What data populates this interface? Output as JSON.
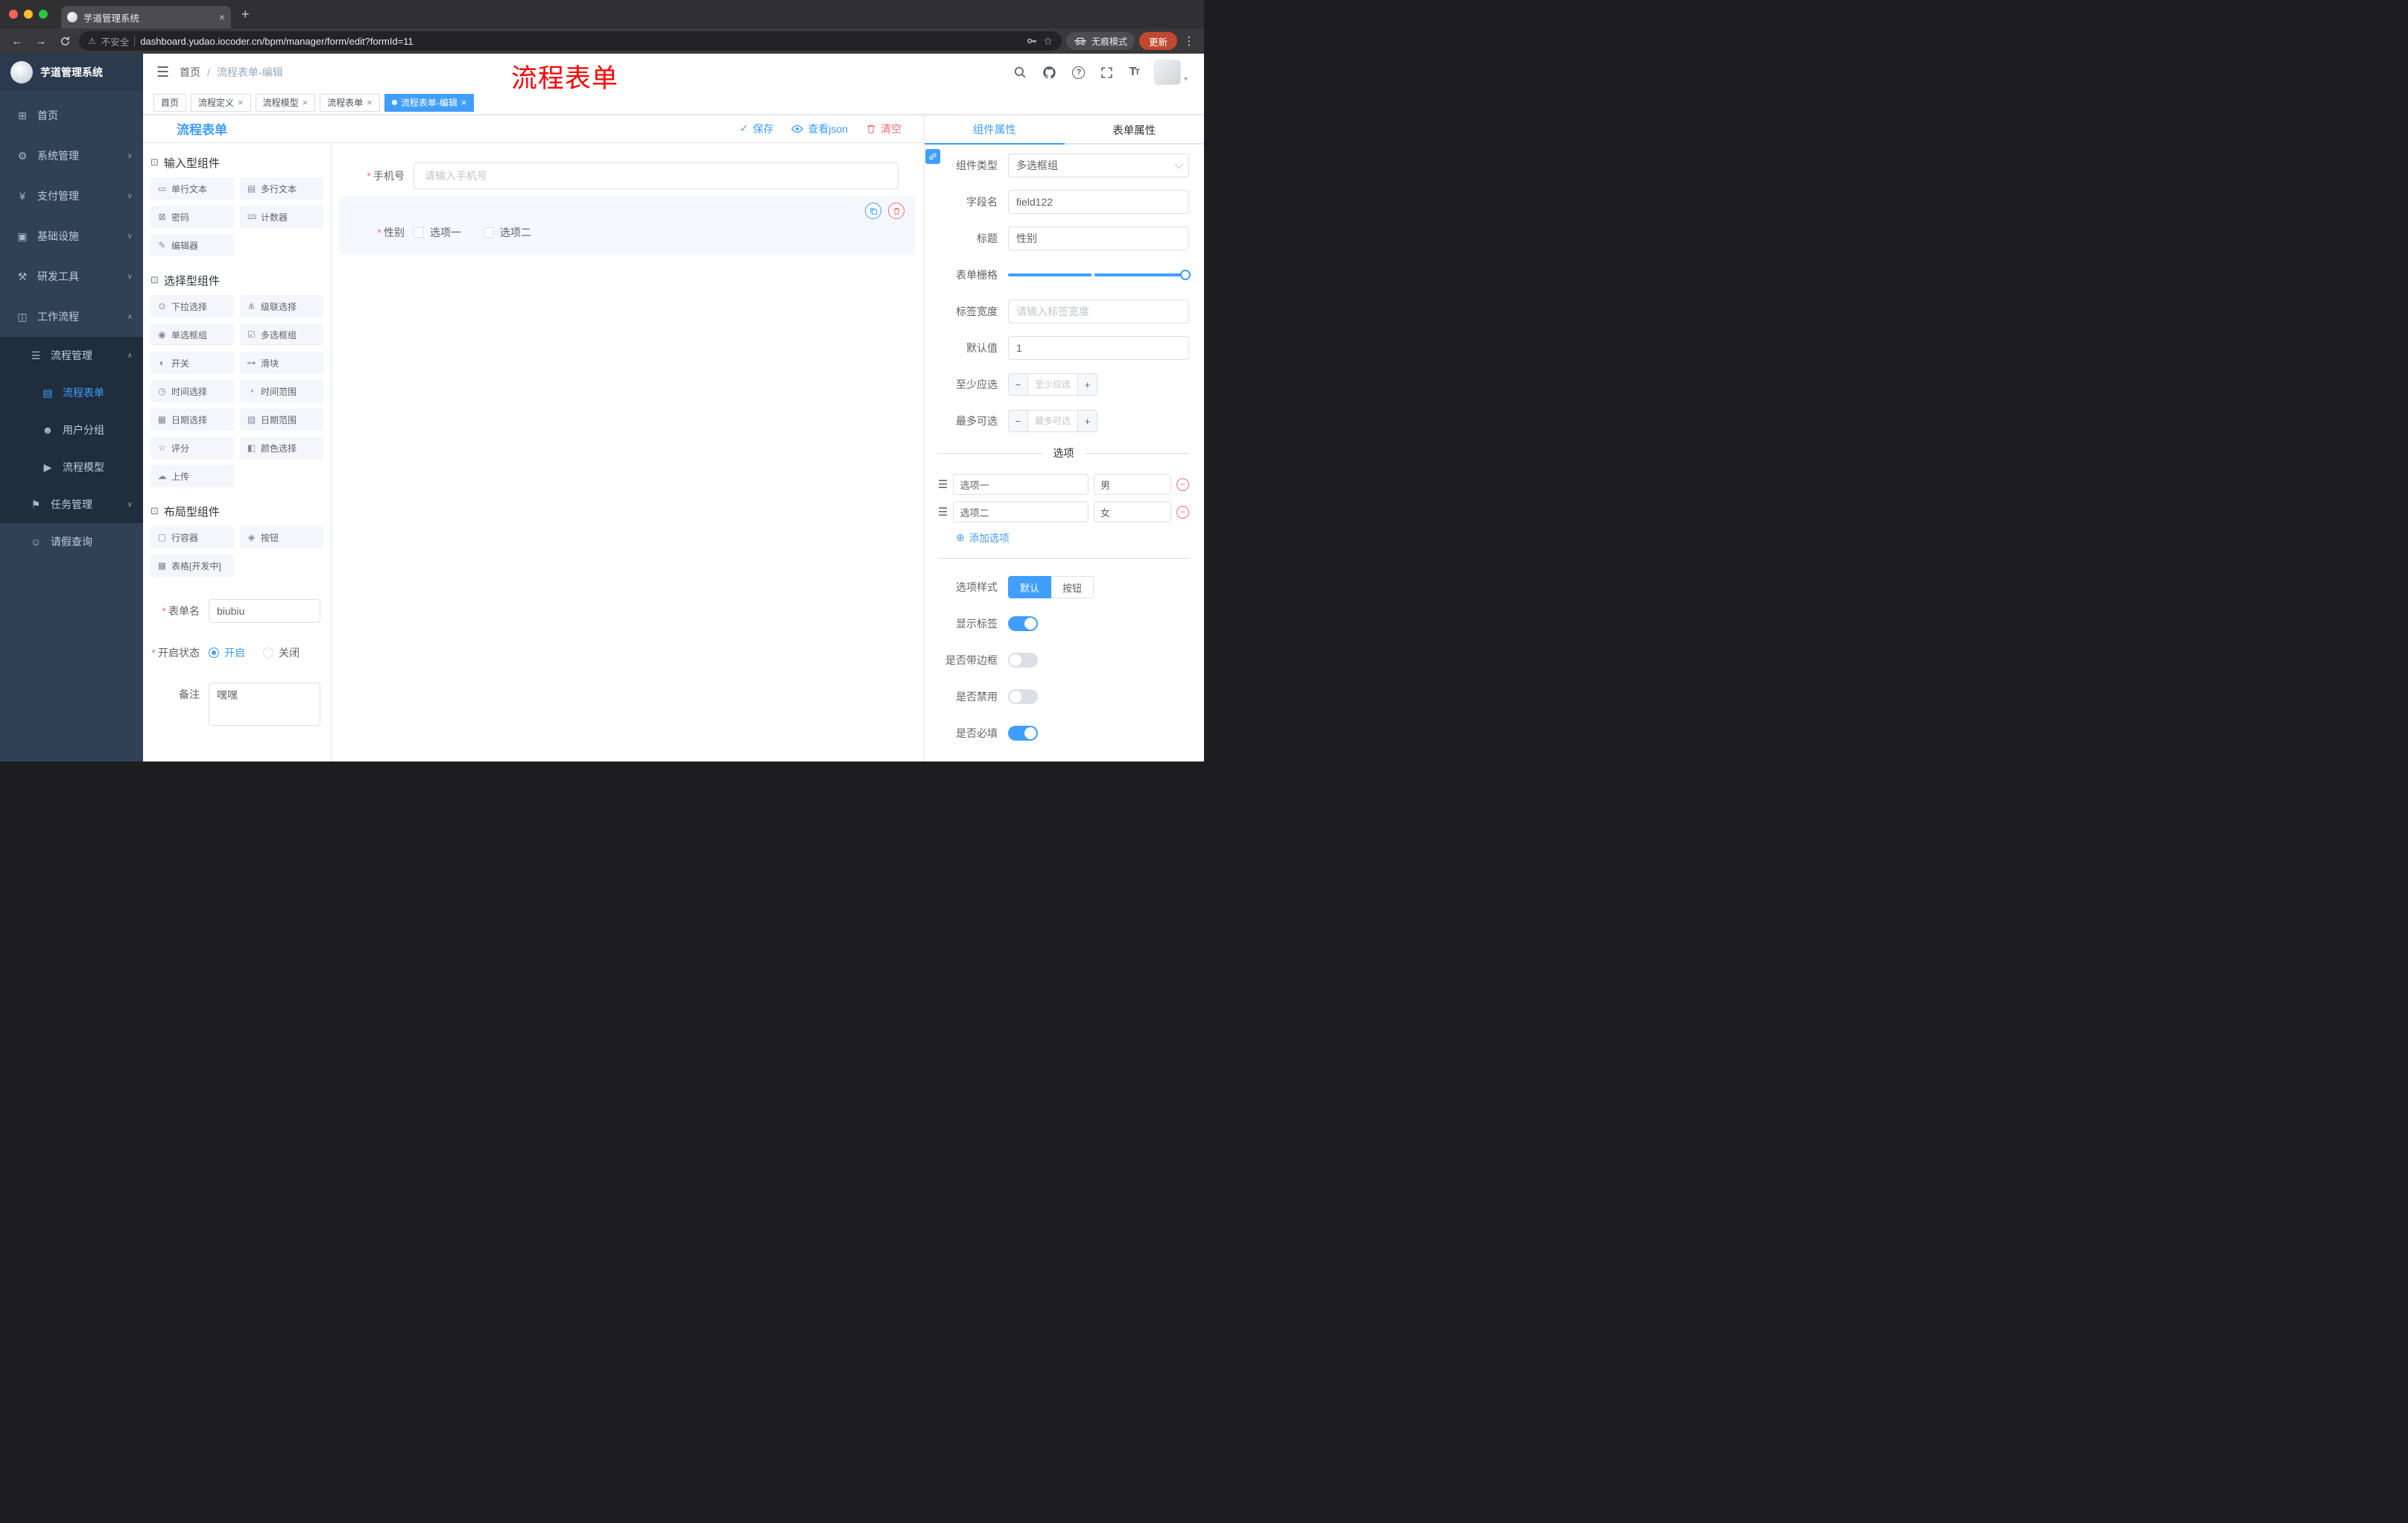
{
  "accent": {
    "primary": "#409EFF",
    "danger": "#F56C6C",
    "sidebar_bg": "#304156",
    "submenu_bg": "#1f2d3d",
    "annotation_red": "#FE0000"
  },
  "icons": {
    "close": "×",
    "plus": "+",
    "minus": "−",
    "back": "←",
    "forward": "→",
    "menu_dots": "⋮",
    "warning": "⚠",
    "star": "☆",
    "hamburger": "☰",
    "chevron_down": "∨",
    "chevron_up": "∧",
    "check": "✓",
    "asterisk": "*",
    "group": "⊡",
    "add_circle": "⊕",
    "caret_down": "▾",
    "size_t": "T"
  },
  "browser": {
    "tab_title": "芋道管理系统",
    "security_label": "不安全",
    "url": "dashboard.yudao.iocoder.cn/bpm/manager/form/edit?formId=11",
    "incognito_label": "无痕模式",
    "update_label": "更新"
  },
  "sidebar": {
    "app_title": "芋道管理系统",
    "menu": [
      {
        "label": "首页",
        "icon": "⊞"
      },
      {
        "label": "系统管理",
        "icon": "⚙",
        "chevron": "∨"
      },
      {
        "label": "支付管理",
        "icon": "¥",
        "chevron": "∨"
      },
      {
        "label": "基础设施",
        "icon": "▣",
        "chevron": "∨"
      },
      {
        "label": "研发工具",
        "icon": "⚒",
        "chevron": "∨"
      },
      {
        "label": "工作流程",
        "icon": "◫",
        "chevron": "∧"
      }
    ],
    "process_manage": {
      "label": "流程管理",
      "icon": "☰",
      "chevron": "∧"
    },
    "process_children": [
      {
        "label": "流程表单",
        "icon": "▤"
      },
      {
        "label": "用户分组",
        "icon": "☻"
      },
      {
        "label": "流程模型",
        "icon": "▶"
      }
    ],
    "task_manage": {
      "label": "任务管理",
      "icon": "⚑",
      "chevron": "∨"
    },
    "leave_query": {
      "label": "请假查询",
      "icon": "☺"
    }
  },
  "header": {
    "breadcrumb_home": "首页",
    "breadcrumb_sep": "/",
    "breadcrumb_current": "流程表单-编辑",
    "annotation": "流程表单"
  },
  "tags": [
    {
      "label": "首页"
    },
    {
      "label": "流程定义"
    },
    {
      "label": "流程模型"
    },
    {
      "label": "流程表单"
    },
    {
      "label": "流程表单-编辑"
    }
  ],
  "designer": {
    "title": "流程表单",
    "actions": {
      "save": "保存",
      "view_json": "查看json",
      "clear": "清空"
    },
    "groups": [
      {
        "title": "输入型组件",
        "items": [
          {
            "label": "单行文本",
            "icon": "▭"
          },
          {
            "label": "多行文本",
            "icon": "▤"
          },
          {
            "label": "密码",
            "icon": "⊠"
          },
          {
            "label": "计数器",
            "icon": "123"
          },
          {
            "label": "编辑器",
            "icon": "✎"
          }
        ]
      },
      {
        "title": "选择型组件",
        "items": [
          {
            "label": "下拉选择",
            "icon": "⊙"
          },
          {
            "label": "级联选择",
            "icon": "⋔"
          },
          {
            "label": "单选框组",
            "icon": "◉"
          },
          {
            "label": "多选框组",
            "icon": "☑"
          },
          {
            "label": "开关",
            "icon": "◐"
          },
          {
            "label": "滑块",
            "icon": "⊶"
          },
          {
            "label": "时间选择",
            "icon": "◷"
          },
          {
            "label": "时间范围",
            "icon": "◔"
          },
          {
            "label": "日期选择",
            "icon": "▦"
          },
          {
            "label": "日期范围",
            "icon": "▧"
          },
          {
            "label": "评分",
            "icon": "☆"
          },
          {
            "label": "颜色选择",
            "icon": "◧"
          },
          {
            "label": "上传",
            "icon": "☁"
          }
        ]
      },
      {
        "title": "布局型组件",
        "items": [
          {
            "label": "行容器",
            "icon": "▢"
          },
          {
            "label": "按钮",
            "icon": "◈"
          },
          {
            "label": "表格[开发中]",
            "icon": "▩"
          }
        ]
      }
    ],
    "meta": {
      "name_label": "表单名",
      "name_value": "biubiu",
      "status_label": "开启状态",
      "status_on": "开启",
      "status_off": "关闭",
      "remark_label": "备注",
      "remark_value": "嘿嘿"
    },
    "canvas": {
      "phone_label": "手机号",
      "phone_placeholder": "请输入手机号",
      "gender_label": "性别",
      "gender_options": [
        "选项一",
        "选项二"
      ]
    }
  },
  "props": {
    "tab_component": "组件属性",
    "tab_form": "表单属性",
    "type_label": "组件类型",
    "type_value": "多选框组",
    "field_label": "字段名",
    "field_value": "field122",
    "title_label": "标题",
    "title_value": "性别",
    "grid_label": "表单栅格",
    "width_label": "标签宽度",
    "width_placeholder": "请输入标签宽度",
    "default_label": "默认值",
    "default_value": "1",
    "min_label": "至少应选",
    "min_placeholder": "至少应选",
    "max_label": "最多可选",
    "max_placeholder": "最多可选",
    "options_divider": "选项",
    "option_rows": [
      {
        "label": "选项一",
        "value": "男"
      },
      {
        "label": "选项二",
        "value": "女"
      }
    ],
    "add_option": "添加选项",
    "style_label": "选项样式",
    "style_default": "默认",
    "style_button": "按钮",
    "switch_show_label": "显示标签",
    "switch_border": "是否带边框",
    "switch_disabled": "是否禁用",
    "switch_required": "是否必填"
  }
}
